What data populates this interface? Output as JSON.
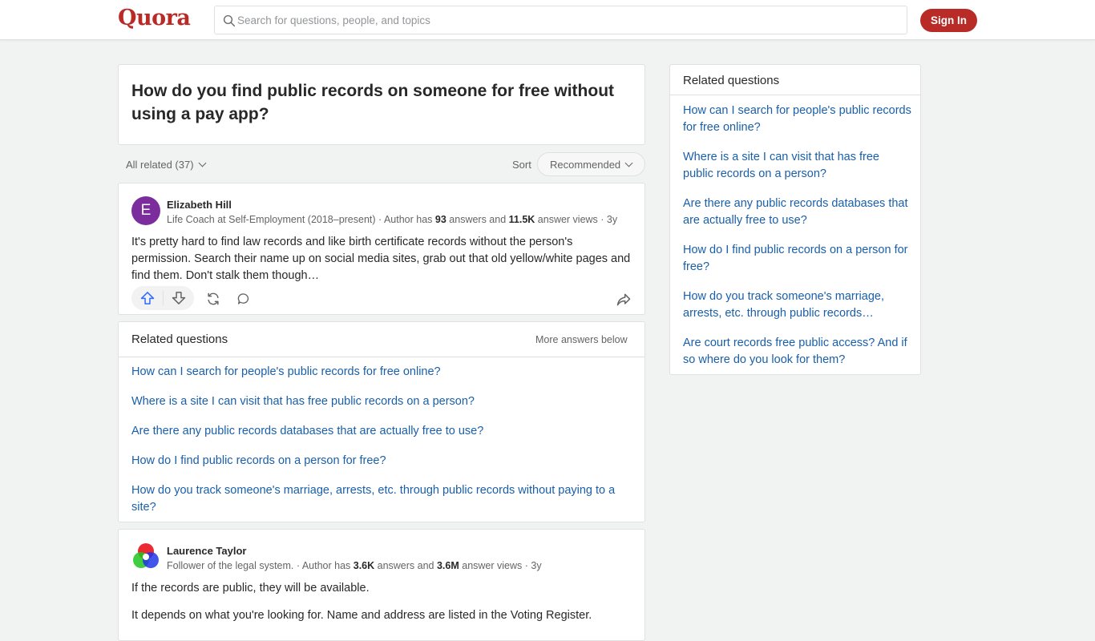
{
  "header": {
    "logo": "Quora",
    "search_placeholder": "Search for questions, people, and topics",
    "signin_label": "Sign In"
  },
  "question": {
    "title": "How do you find public records on someone for free without using a pay app?"
  },
  "filters": {
    "all_related": "All related (37)",
    "sort_label": "Sort",
    "sort_value": "Recommended"
  },
  "answers": [
    {
      "avatar_letter": "E",
      "author": "Elizabeth Hill",
      "meta_prefix": "Life Coach at Self-Employment (2018–present) · Author has ",
      "answers_count": "93",
      "meta_mid": " answers and ",
      "views_count": "11.5K",
      "meta_suffix": " answer views · 3y",
      "text": "It's pretty hard to find law records and like birth certificate records without the person's permission. Search their name up on social media sites, grab out that old yellow/white pages and find them. Don't stalk them though…"
    },
    {
      "author": "Laurence Taylor",
      "meta_prefix": "Follower of the legal system. · Author has ",
      "answers_count": "3.6K",
      "meta_mid": " answers and ",
      "views_count": "3.6M",
      "meta_suffix": " answer views · 3y",
      "text": "If the records are public, they will be available.",
      "text2": "It depends on what you're looking for. Name and address are listed in the Voting Register."
    }
  ],
  "inline_related": {
    "title": "Related questions",
    "more_below": "More answers below",
    "items": [
      "How can I search for people's public records for free online?",
      "Where is a site I can visit that has free public records on a person?",
      "Are there any public records databases that are actually free to use?",
      "How do I find public records on a person for free?",
      "How do you track someone's marriage, arrests, etc. through public records without paying to a site?"
    ]
  },
  "sidebar": {
    "title": "Related questions",
    "items": [
      "How can I search for people's public records for free online?",
      "Where is a site I can visit that has free public records on a person?",
      "Are there any public records databases that are actually free to use?",
      "How do I find public records on a person for free?",
      "How do you track someone's marriage, arrests, etc. through public records…",
      "Are court records free public access? And if so where do you look for them?"
    ]
  },
  "colors": {
    "brand": "#b92b27",
    "link": "#195faa",
    "upvote": "#2e69ff"
  }
}
